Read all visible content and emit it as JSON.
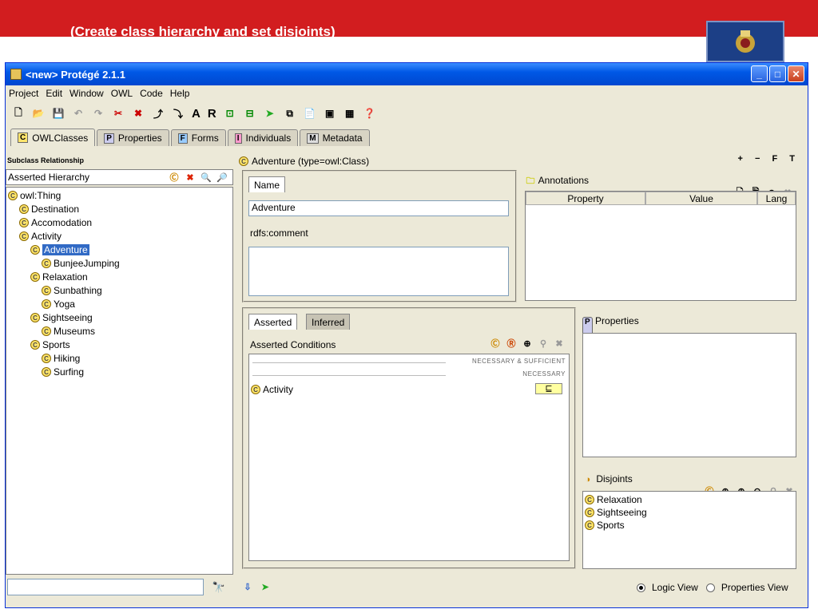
{
  "slide": {
    "caption": "(Create class hierarchy and set disjoints)"
  },
  "window": {
    "title": "<new>  Protégé 2.1.1"
  },
  "menu": [
    "Project",
    "Edit",
    "Window",
    "OWL",
    "Code",
    "Help"
  ],
  "toolbar": {
    "a_label": "A",
    "r_label": "R"
  },
  "tabs": [
    {
      "label": "OWLClasses",
      "icon": "C"
    },
    {
      "label": "Properties",
      "icon": "P"
    },
    {
      "label": "Forms",
      "icon": "F"
    },
    {
      "label": "Individuals",
      "icon": "I"
    },
    {
      "label": "Metadata",
      "icon": "M"
    }
  ],
  "left": {
    "header": "Subclass Relationship",
    "subheader": "Asserted Hierarchy",
    "tree": [
      {
        "label": "owl:Thing",
        "depth": 0
      },
      {
        "label": "Destination",
        "depth": 1
      },
      {
        "label": "Accomodation",
        "depth": 1
      },
      {
        "label": "Activity",
        "depth": 1
      },
      {
        "label": "Adventure",
        "depth": 2,
        "selected": true
      },
      {
        "label": "BunjeeJumping",
        "depth": 3
      },
      {
        "label": "Relaxation",
        "depth": 2
      },
      {
        "label": "Sunbathing",
        "depth": 3
      },
      {
        "label": "Yoga",
        "depth": 3
      },
      {
        "label": "Sightseeing",
        "depth": 2
      },
      {
        "label": "Museums",
        "depth": 3
      },
      {
        "label": "Sports",
        "depth": 2
      },
      {
        "label": "Hiking",
        "depth": 3
      },
      {
        "label": "Surfing",
        "depth": 3
      }
    ]
  },
  "center": {
    "header": "Adventure   (type=owl:Class)",
    "controls": "+ − F T",
    "name_tab": "Name",
    "name_value": "Adventure",
    "comment_label": "rdfs:comment",
    "annotations": {
      "label": "Annotations",
      "columns": [
        "Property",
        "Value",
        "Lang"
      ]
    },
    "conditions": {
      "tab_asserted": "Asserted",
      "tab_inferred": "Inferred",
      "title": "Asserted Conditions",
      "necessary_sufficient": "NECESSARY & SUFFICIENT",
      "necessary": "NECESSARY",
      "item": "Activity",
      "item_op": "⊑"
    },
    "properties": {
      "label": "Properties"
    },
    "disjoints": {
      "label": "Disjoints",
      "items": [
        "Relaxation",
        "Sightseeing",
        "Sports"
      ]
    },
    "footer": {
      "logic_view": "Logic View",
      "properties_view": "Properties View"
    }
  }
}
